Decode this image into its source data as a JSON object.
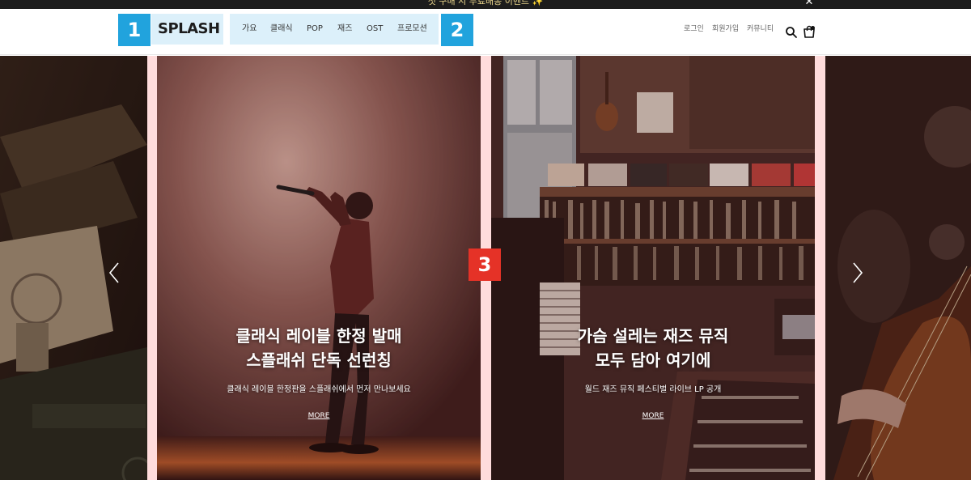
{
  "topbar": {
    "promo_text": "첫 구매 시 무료배송 이벤트 ✨",
    "close_icon": "close-icon"
  },
  "markers": {
    "m1": "1",
    "m2": "2",
    "m3": "3"
  },
  "header": {
    "logo": "SPLASH",
    "nav": [
      "가요",
      "클래식",
      "POP",
      "재즈",
      "OST",
      "프로모션"
    ],
    "util": {
      "login": "로그인",
      "signup": "회원가입",
      "community": "커뮤니티"
    },
    "icons": {
      "search": "search-icon",
      "cart": "shopping-bag-icon"
    }
  },
  "slides": [
    {
      "title_line1": "클래식 레이블 한정 발매",
      "title_line2": "스플래쉬 단독 선런칭",
      "description": "클래식 레이블 한정판을 스플래쉬에서 먼저 만나보세요",
      "more": "MORE"
    },
    {
      "title_line1": "가슴 설레는 재즈 뮤직",
      "title_line2": "모두 담아 여기에",
      "description": "월드 재즈 뮤직 페스티벌 라이브 LP 공개",
      "more": "MORE"
    }
  ],
  "slider_icons": {
    "prev": "chevron-left-icon",
    "next": "chevron-right-icon"
  },
  "colors": {
    "topbar": "#1c1c1c",
    "marker_blue": "#21a3dd",
    "marker_red": "#e53227",
    "highlight_bg": "#dcf0fa",
    "visual_bg": "#ffdcdc"
  }
}
